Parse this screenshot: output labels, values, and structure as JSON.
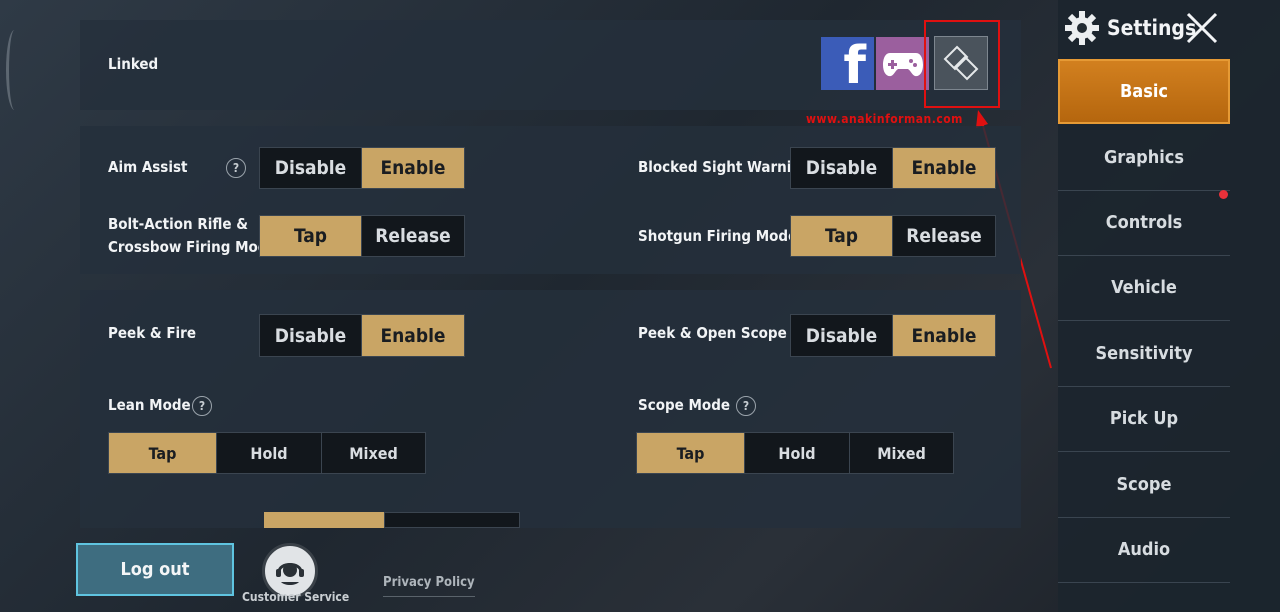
{
  "linked": {
    "label": "Linked",
    "icons": [
      "facebook-icon",
      "gamepad-icon",
      "unlink-icon"
    ]
  },
  "watermark": "www.anakinforman.com",
  "settings_a": {
    "aim_assist": {
      "label": "Aim Assist",
      "options": [
        "Disable",
        "Enable"
      ],
      "selected": "Enable"
    },
    "bolt_action": {
      "label_line1": "Bolt-Action Rifle &",
      "label_line2": "Crossbow Firing Mode",
      "options": [
        "Tap",
        "Release"
      ],
      "selected": "Tap"
    },
    "blocked_sight": {
      "label": "Blocked Sight Warning",
      "options": [
        "Disable",
        "Enable"
      ],
      "selected": "Enable"
    },
    "shotgun_mode": {
      "label": "Shotgun Firing Mode",
      "options": [
        "Tap",
        "Release"
      ],
      "selected": "Tap"
    }
  },
  "settings_b": {
    "peek_fire": {
      "label": "Peek & Fire",
      "options": [
        "Disable",
        "Enable"
      ],
      "selected": "Enable"
    },
    "peek_scope": {
      "label": "Peek & Open Scope",
      "options": [
        "Disable",
        "Enable"
      ],
      "selected": "Enable"
    },
    "lean_mode": {
      "label": "Lean Mode",
      "options": [
        "Tap",
        "Hold",
        "Mixed"
      ],
      "selected": "Tap"
    },
    "scope_mode": {
      "label": "Scope Mode",
      "options": [
        "Tap",
        "Hold",
        "Mixed"
      ],
      "selected": "Tap"
    }
  },
  "footer": {
    "logout": "Log out",
    "customer_service": "Customer Service",
    "privacy_policy": "Privacy Policy"
  },
  "sidebar": {
    "title": "Settings",
    "items": [
      "Basic",
      "Graphics",
      "Controls",
      "Vehicle",
      "Sensitivity",
      "Pick Up",
      "Scope",
      "Audio"
    ],
    "active": "Basic"
  },
  "colors": {
    "selected_option": "#c9a565",
    "active_tab": "#c8761a",
    "annotation_red": "#e01010",
    "logout_border": "#5fc4e0"
  }
}
